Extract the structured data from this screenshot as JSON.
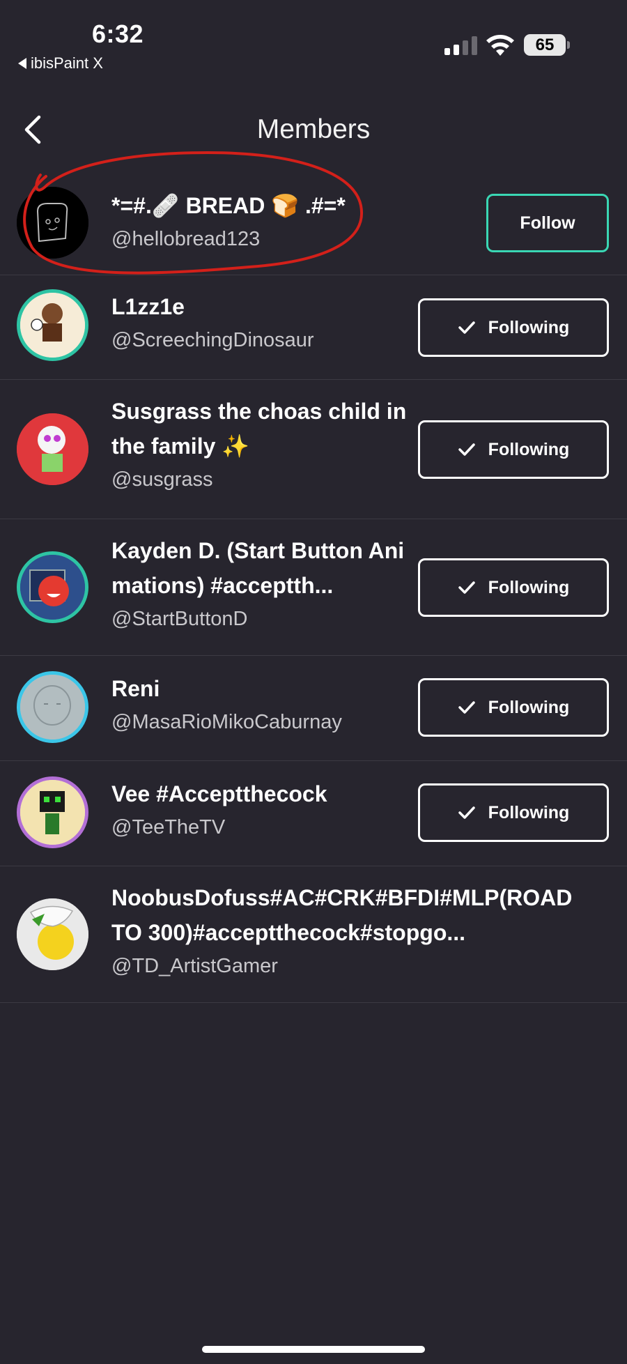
{
  "status_bar": {
    "time": "6:32",
    "back_app_label": "ibisPaint X",
    "battery": "65",
    "icons": [
      "cellular-signal-icon",
      "wifi-icon",
      "battery-icon"
    ]
  },
  "header": {
    "title": "Members",
    "back_icon": "chevron-left-icon"
  },
  "colors": {
    "background": "#27252e",
    "follow_accent": "#3ad7b4",
    "divider": "#3c3a43",
    "annotation": "#d3201a"
  },
  "members": [
    {
      "name": "*=#.🩹 BREAD 🍞 .#=*",
      "handle": "@hellobread123",
      "button": "Follow"
    },
    {
      "name": "L1zz1e",
      "handle": "@ScreechingDinosaur",
      "button": "Following"
    },
    {
      "name": "Susgrass the choas child in the family ✨",
      "handle": "@susgrass",
      "button": "Following"
    },
    {
      "name": "Kayden D. (Start Button Animations) #acceptth...",
      "handle": "@StartButtonD",
      "button": "Following"
    },
    {
      "name": "Reni",
      "handle": "@MasaRioMikoCaburnay",
      "button": "Following"
    },
    {
      "name": "Vee #Acceptthecock",
      "handle": "@TeeTheTV",
      "button": "Following"
    },
    {
      "name": "NoobusDofuss#AC#CRK#BFDI#MLP(ROAD TO 300)#acceptthecock#stopgo...",
      "handle": "@TD_ArtistGamer",
      "button": ""
    }
  ]
}
